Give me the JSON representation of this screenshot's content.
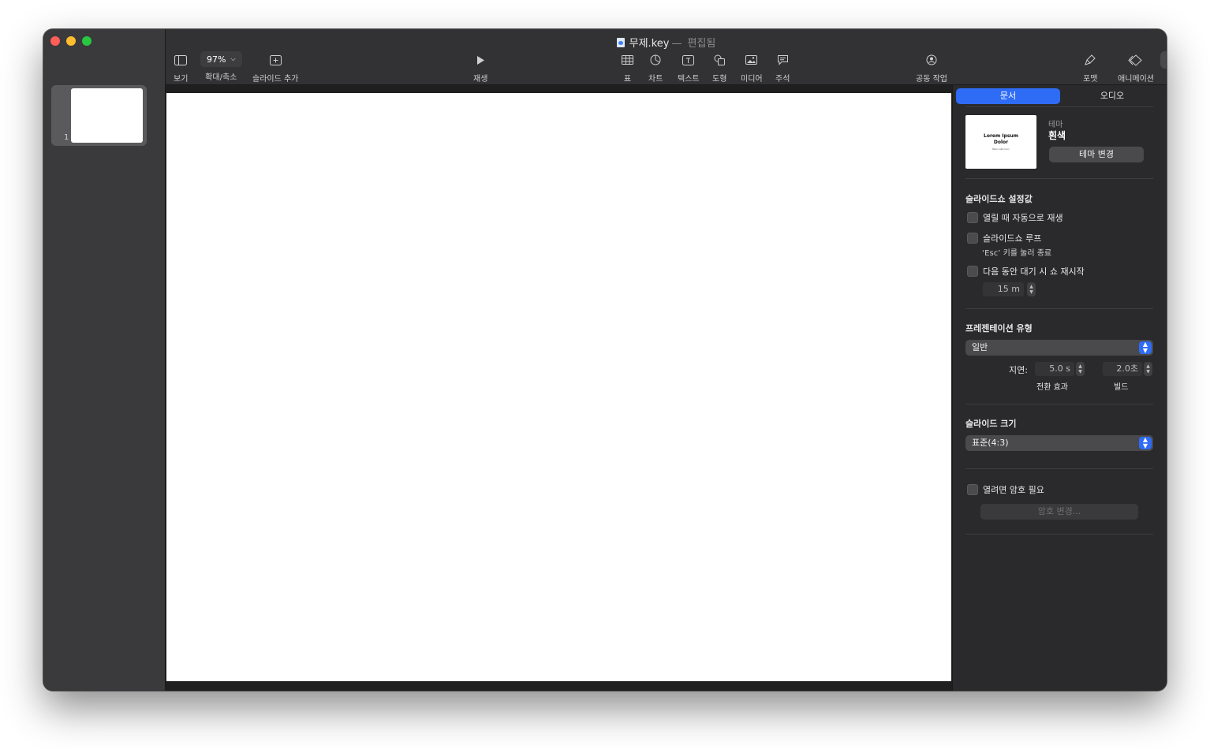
{
  "window": {
    "title": "무제.key",
    "title_separator": "—",
    "edited_label": "편집됨"
  },
  "sidebar": {
    "slides": [
      {
        "number": "1"
      }
    ]
  },
  "toolbar": {
    "view_label": "보기",
    "zoom_value": "97%",
    "zoom_label": "확대/축소",
    "add_slide_label": "슬라이드 추가",
    "play_label": "재생",
    "table_label": "표",
    "chart_label": "차트",
    "text_label": "텍스트",
    "shape_label": "도형",
    "media_label": "미디어",
    "comment_label": "주석",
    "collaborate_label": "공동 작업",
    "format_label": "포맷",
    "animate_label": "애니메이션",
    "document_label": "문서"
  },
  "inspector": {
    "tabs": [
      {
        "label": "문서",
        "active": true
      },
      {
        "label": "오디오",
        "active": false
      }
    ],
    "theme": {
      "thumb_title": "Lorem Ipsum Dolor",
      "thumb_sub": "Nunc est nunc",
      "caption": "테마",
      "name": "흰색",
      "change_button": "테마 변경"
    },
    "slideshow": {
      "title": "슬라이드쇼 설정값",
      "autoplay": {
        "label": "열릴 때 자동으로 재생",
        "checked": false
      },
      "loop": {
        "label": "슬라이드쇼 루프",
        "checked": false
      },
      "esc_note": "‘Esc’ 키를 눌러 종료",
      "restart": {
        "label": "다음 동안 대기 시 쇼 재시작",
        "checked": false
      },
      "restart_value": "15 m"
    },
    "presentation": {
      "title": "프레젠테이션 유형",
      "type_value": "일반",
      "delay_label": "지연:",
      "transition_value": "5.0 s",
      "transition_label": "전환 효과",
      "build_value": "2.0초",
      "build_label": "빌드"
    },
    "slide_size": {
      "title": "슬라이드 크기",
      "value": "표준(4:3)"
    },
    "password": {
      "label": "열려면 암호 필요",
      "checked": false,
      "change_button": "암호 변경..."
    }
  },
  "colors": {
    "accent": "#2f6cf5",
    "close": "#ff5f57",
    "minimize": "#febc2e",
    "zoom": "#28c840"
  }
}
